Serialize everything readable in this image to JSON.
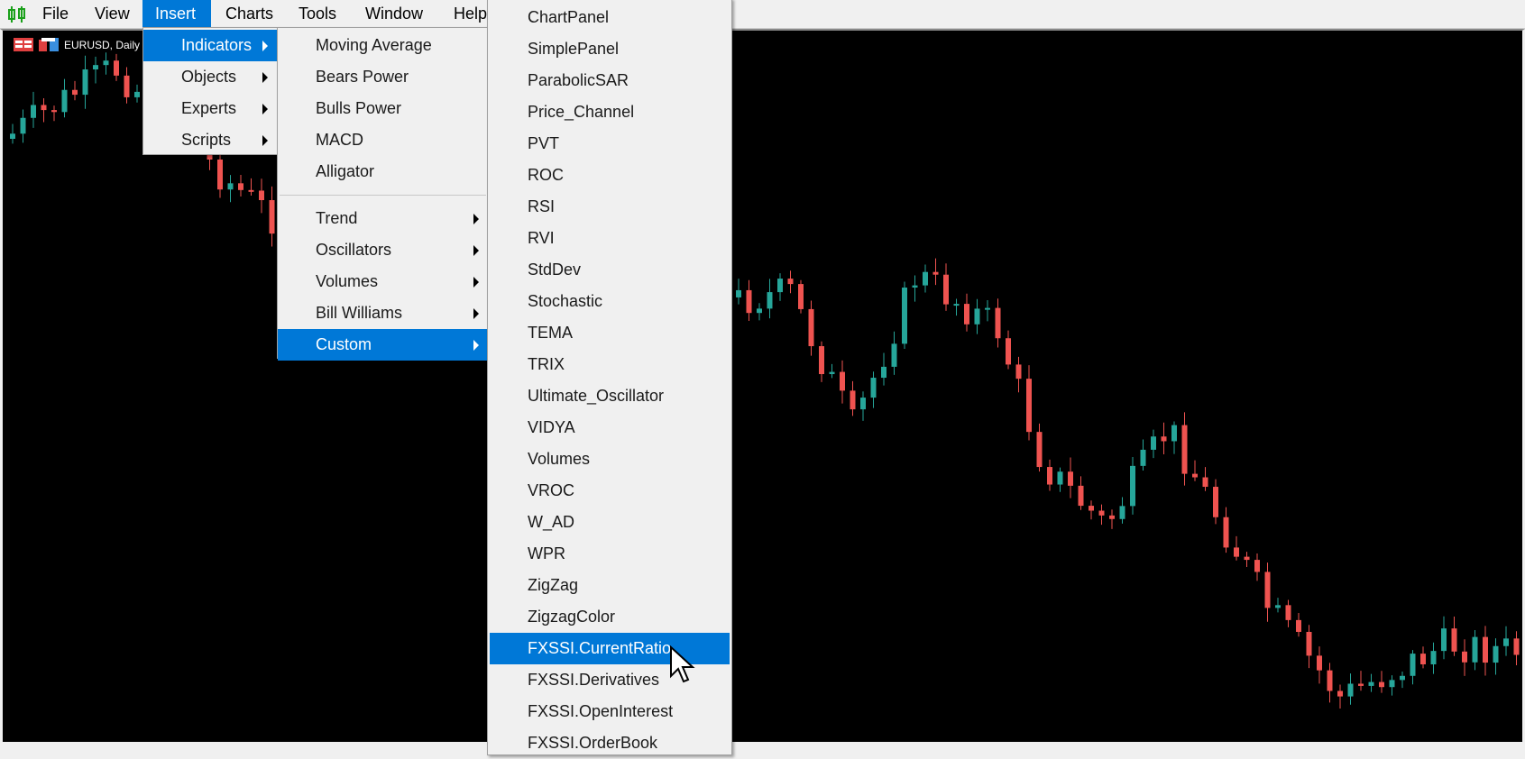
{
  "menubar": {
    "items": [
      {
        "label": "File"
      },
      {
        "label": "View"
      },
      {
        "label": "Insert",
        "active": true
      },
      {
        "label": "Charts"
      },
      {
        "label": "Tools"
      },
      {
        "label": "Window"
      },
      {
        "label": "Help"
      }
    ]
  },
  "chart": {
    "title": "EURUSD, Daily",
    "bull_color": "#26a69a",
    "bear_color": "#ef5350",
    "background": "#000000"
  },
  "insert_menu": {
    "items": [
      "Indicators",
      "Objects",
      "Experts",
      "Scripts"
    ],
    "highlighted": "Indicators"
  },
  "indicators_menu": {
    "top": [
      "Moving Average",
      "Bears Power",
      "Bulls Power",
      "MACD",
      "Alligator"
    ],
    "groups": [
      "Trend",
      "Oscillators",
      "Volumes",
      "Bill Williams",
      "Custom"
    ],
    "highlighted": "Custom"
  },
  "custom_menu": {
    "items": [
      "ChartPanel",
      "SimplePanel",
      "ParabolicSAR",
      "Price_Channel",
      "PVT",
      "ROC",
      "RSI",
      "RVI",
      "StdDev",
      "Stochastic",
      "TEMA",
      "TRIX",
      "Ultimate_Oscillator",
      "VIDYA",
      "Volumes",
      "VROC",
      "W_AD",
      "WPR",
      "ZigZag",
      "ZigzagColor",
      "FXSSI.CurrentRatio",
      "FXSSI.Derivatives",
      "FXSSI.OpenInterest",
      "FXSSI.OrderBook"
    ],
    "highlighted": "FXSSI.CurrentRatio"
  },
  "accent": "#0078d7"
}
